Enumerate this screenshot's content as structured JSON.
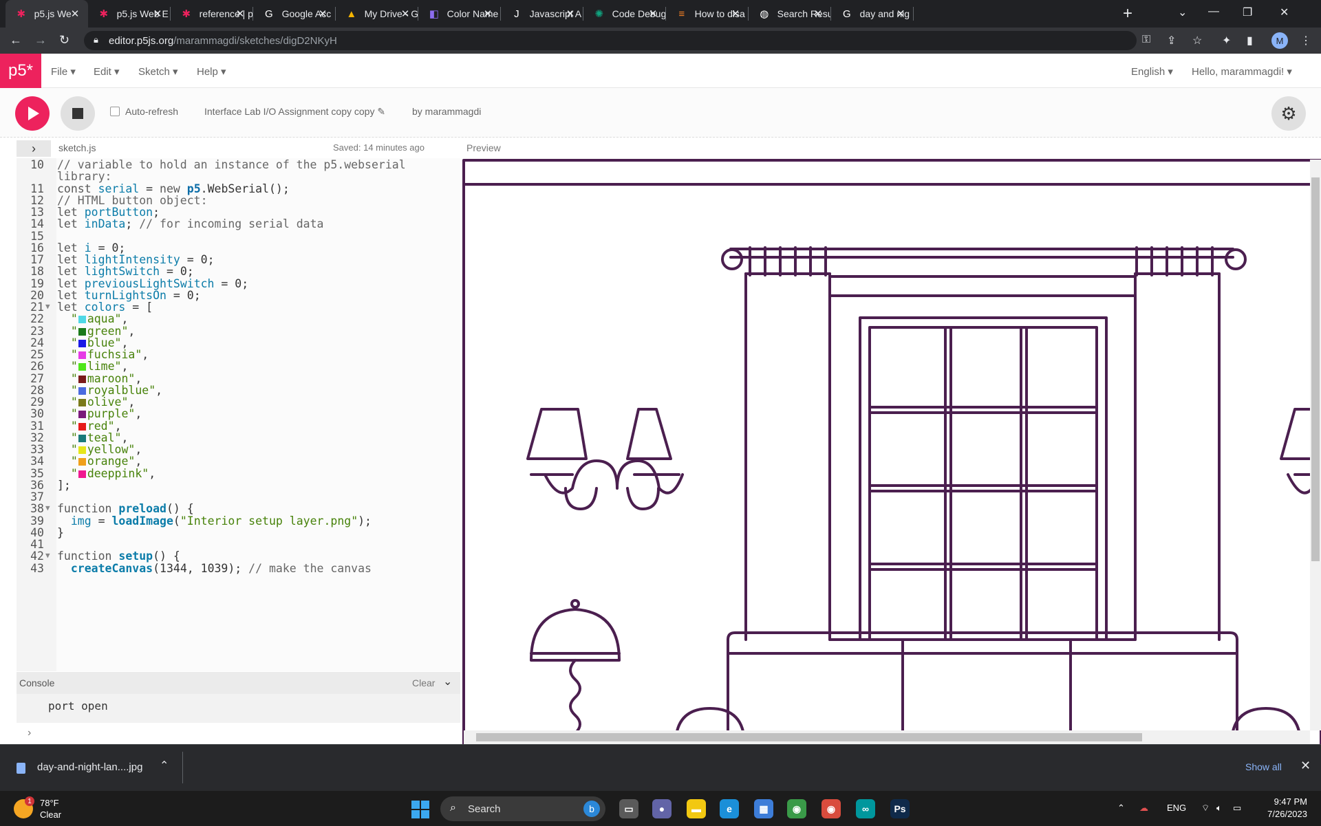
{
  "browser": {
    "tabs": [
      {
        "label": "p5.js We",
        "icon": "p5-star-icon",
        "active": true
      },
      {
        "label": "p5.js Web E",
        "icon": "p5-star-icon"
      },
      {
        "label": "reference | p5",
        "icon": "p5-star-icon"
      },
      {
        "label": "Google Acc",
        "icon": "google-icon"
      },
      {
        "label": "My Drive - G",
        "icon": "drive-icon"
      },
      {
        "label": "Color Name",
        "icon": "color-icon"
      },
      {
        "label": "Javascript A",
        "icon": "js-icon"
      },
      {
        "label": "Code Debug",
        "icon": "chatgpt-icon"
      },
      {
        "label": "How to disa",
        "icon": "stackoverflow-icon"
      },
      {
        "label": "Search Resu",
        "icon": "globe-icon"
      },
      {
        "label": "day and nig",
        "icon": "google-icon"
      }
    ],
    "url_host": "editor.p5js.org",
    "url_path": "/marammagdi/sketches/digD2NKyH",
    "profile_initial": "M"
  },
  "p5": {
    "logo": "p5*",
    "menus": [
      "File",
      "Edit",
      "Sketch",
      "Help"
    ],
    "language": "English",
    "greeting": "Hello, marammagdi!",
    "auto_refresh_label": "Auto-refresh",
    "sketch_name": "Interface Lab I/O Assignment copy copy",
    "by_line": "by marammagdi",
    "file_name": "sketch.js",
    "saved_status": "Saved: 14 minutes ago",
    "preview_label": "Preview",
    "console_label": "Console",
    "clear_label": "Clear",
    "console_output": "port open",
    "console_prompt": "›"
  },
  "code_lines": [
    {
      "n": "10",
      "fold": "",
      "text": "// variable to hold an instance of the p5.webserial"
    },
    {
      "n": "",
      "fold": "",
      "text": "library:"
    },
    {
      "n": "11",
      "fold": "",
      "text": "const serial = new p5.WebSerial();"
    },
    {
      "n": "12",
      "fold": "",
      "text": "// HTML button object:"
    },
    {
      "n": "13",
      "fold": "",
      "text": "let portButton;"
    },
    {
      "n": "14",
      "fold": "",
      "text": "let inData; // for incoming serial data"
    },
    {
      "n": "15",
      "fold": "",
      "text": ""
    },
    {
      "n": "16",
      "fold": "",
      "text": "let i = 0;"
    },
    {
      "n": "17",
      "fold": "",
      "text": "let lightIntensity = 0;"
    },
    {
      "n": "18",
      "fold": "",
      "text": "let lightSwitch = 0;"
    },
    {
      "n": "19",
      "fold": "",
      "text": "let previousLightSwitch = 0;"
    },
    {
      "n": "20",
      "fold": "",
      "text": "let turnLightsOn = 0;"
    },
    {
      "n": "21",
      "fold": "▼",
      "text": "let colors = ["
    },
    {
      "n": "22",
      "fold": "",
      "text": "  \"aqua\",",
      "swatch": "#4fd8e6"
    },
    {
      "n": "23",
      "fold": "",
      "text": "  \"green\",",
      "swatch": "#1a7a1a"
    },
    {
      "n": "24",
      "fold": "",
      "text": "  \"blue\",",
      "swatch": "#1a1ae6"
    },
    {
      "n": "25",
      "fold": "",
      "text": "  \"fuchsia\",",
      "swatch": "#e63ae6"
    },
    {
      "n": "26",
      "fold": "",
      "text": "  \"lime\",",
      "swatch": "#4fe61a"
    },
    {
      "n": "27",
      "fold": "",
      "text": "  \"maroon\",",
      "swatch": "#7a1a1a"
    },
    {
      "n": "28",
      "fold": "",
      "text": "  \"royalblue\",",
      "swatch": "#4a6ae0"
    },
    {
      "n": "29",
      "fold": "",
      "text": "  \"olive\",",
      "swatch": "#7a7a1a"
    },
    {
      "n": "30",
      "fold": "",
      "text": "  \"purple\",",
      "swatch": "#7a1a7a"
    },
    {
      "n": "31",
      "fold": "",
      "text": "  \"red\",",
      "swatch": "#e61a1a"
    },
    {
      "n": "32",
      "fold": "",
      "text": "  \"teal\",",
      "swatch": "#1a7a7a"
    },
    {
      "n": "33",
      "fold": "",
      "text": "  \"yellow\",",
      "swatch": "#e6e61a"
    },
    {
      "n": "34",
      "fold": "",
      "text": "  \"orange\",",
      "swatch": "#f0a01a"
    },
    {
      "n": "35",
      "fold": "",
      "text": "  \"deeppink\",",
      "swatch": "#f01a90"
    },
    {
      "n": "36",
      "fold": "",
      "text": "];"
    },
    {
      "n": "37",
      "fold": "",
      "text": ""
    },
    {
      "n": "38",
      "fold": "▼",
      "text": "function preload() {"
    },
    {
      "n": "39",
      "fold": "",
      "text": "  img = loadImage(\"Interior setup layer.png\");"
    },
    {
      "n": "40",
      "fold": "",
      "text": "}"
    },
    {
      "n": "41",
      "fold": "",
      "text": ""
    },
    {
      "n": "42",
      "fold": "▼",
      "text": "function setup() {"
    },
    {
      "n": "43",
      "fold": "",
      "text": "  createCanvas(1344, 1039); // make the canvas"
    }
  ],
  "downloads": {
    "file": "day-and-night-lan....jpg",
    "show_all": "Show all"
  },
  "taskbar": {
    "weather_badge": "1",
    "temperature": "78°F",
    "condition": "Clear",
    "search_placeholder": "Search",
    "language": "ENG",
    "time": "9:47 PM",
    "date": "7/26/2023",
    "apps": [
      {
        "name": "task-view-icon",
        "color": "#5a5a5a",
        "glyph": "▭"
      },
      {
        "name": "teams-icon",
        "color": "#6264a7",
        "glyph": "●"
      },
      {
        "name": "file-explorer-icon",
        "color": "#f2c811",
        "glyph": "▬"
      },
      {
        "name": "edge-icon",
        "color": "#1b8fd8",
        "glyph": "e"
      },
      {
        "name": "store-icon",
        "color": "#3d7dd8",
        "glyph": "▦"
      },
      {
        "name": "chrome-icon",
        "color": "#3a9a48",
        "glyph": "◉"
      },
      {
        "name": "chrome-profile-icon",
        "color": "#d94c3d",
        "glyph": "◉"
      },
      {
        "name": "arduino-icon",
        "color": "#00979d",
        "glyph": "∞"
      },
      {
        "name": "photoshop-icon",
        "color": "#0f2a4a",
        "glyph": "Ps"
      }
    ]
  }
}
